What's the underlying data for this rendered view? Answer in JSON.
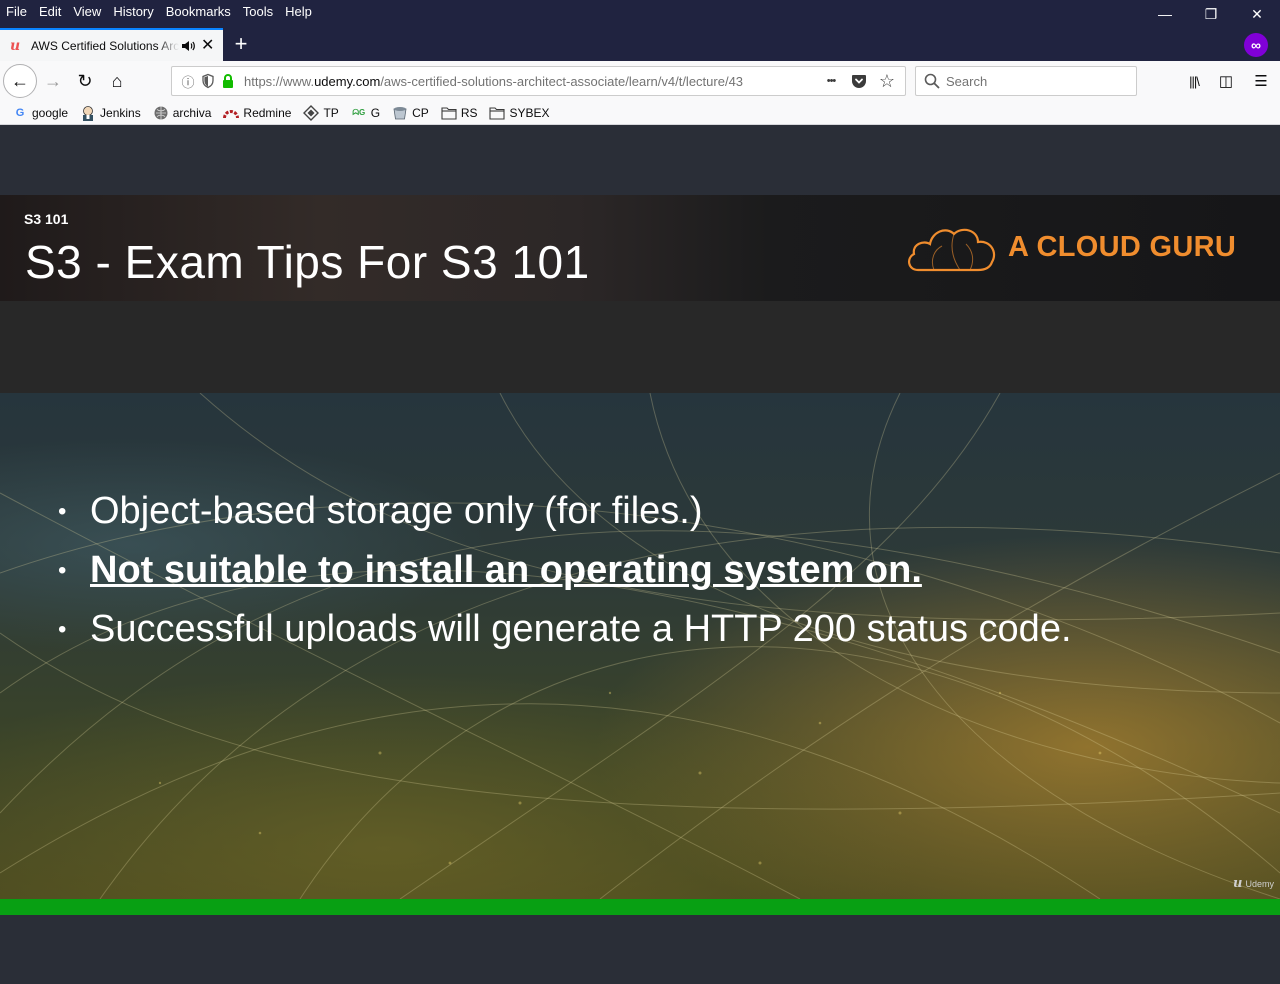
{
  "menu": {
    "items": [
      {
        "label": "File"
      },
      {
        "label": "Edit"
      },
      {
        "label": "View"
      },
      {
        "label": "History"
      },
      {
        "label": "Bookmarks"
      },
      {
        "label": "Tools"
      },
      {
        "label": "Help"
      }
    ]
  },
  "window": {
    "minimize_glyph": "—",
    "restore_glyph": "❐",
    "close_glyph": "✕"
  },
  "tab": {
    "favicon": "u",
    "title": "AWS Certified Solutions Architect",
    "close_glyph": "✕",
    "new_tab_glyph": "+"
  },
  "extension": {
    "glyph": "∞"
  },
  "nav": {
    "back_glyph": "←",
    "forward_glyph": "→",
    "reload_glyph": "↻",
    "home_glyph": "⌂"
  },
  "url": {
    "info_glyph": "ⓘ",
    "prefix": "https://www.",
    "domain": "udemy.com",
    "path": "/aws-certified-solutions-architect-associate/learn/v4/t/lecture/43",
    "more_glyph": "•••",
    "star_glyph": "☆"
  },
  "search": {
    "placeholder": "Search"
  },
  "toolbar": {
    "library_glyph": "|||\\",
    "sidebar_glyph": "◫",
    "menu_glyph": "☰"
  },
  "bookmarks": [
    {
      "label": "google",
      "icon": "google-icon"
    },
    {
      "label": "Jenkins",
      "icon": "jenkins-icon"
    },
    {
      "label": "archiva",
      "icon": "archiva-icon"
    },
    {
      "label": "Redmine",
      "icon": "redmine-icon"
    },
    {
      "label": "TP",
      "icon": "tp-icon"
    },
    {
      "label": "G",
      "icon": "g-icon"
    },
    {
      "label": "CP",
      "icon": "cp-icon"
    },
    {
      "label": "RS",
      "icon": "folder-icon"
    },
    {
      "label": "SYBEX",
      "icon": "folder-icon"
    }
  ],
  "slide": {
    "kicker": "S3 101",
    "title": "S3 - Exam Tips For S3 101",
    "brand": "A CLOUD GURU",
    "bullets": [
      {
        "text": "Object-based storage only (for files.)",
        "strong": false
      },
      {
        "text": "Not suitable to install an operating system on.",
        "strong": true
      },
      {
        "text": "Successful uploads will generate a HTTP 200 status code.",
        "strong": false
      }
    ],
    "bullet_glyph": "•",
    "watermark": "Udemy"
  },
  "colors": {
    "brand_orange": "#f08d2e",
    "progress_green": "#08a013",
    "titlebar": "#202340"
  }
}
